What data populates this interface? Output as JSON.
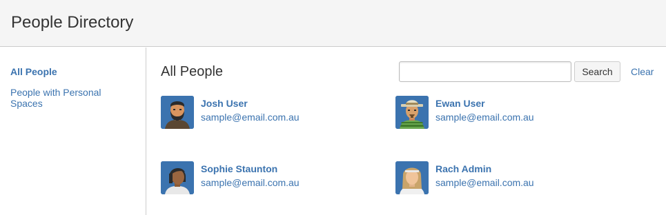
{
  "header": {
    "title": "People Directory"
  },
  "sidebar": {
    "items": [
      {
        "label": "All People",
        "active": true
      },
      {
        "label": "People with Personal Spaces",
        "active": false
      }
    ]
  },
  "main": {
    "title": "All People",
    "search": {
      "value": "",
      "placeholder": "",
      "button_label": "Search",
      "clear_label": "Clear"
    },
    "people": [
      {
        "name": "Josh User",
        "email": "sample@email.com.au",
        "avatar_icon": "bearded-man-avatar-icon"
      },
      {
        "name": "Ewan User",
        "email": "sample@email.com.au",
        "avatar_icon": "hat-man-avatar-icon"
      },
      {
        "name": "Sophie Staunton",
        "email": "sample@email.com.au",
        "avatar_icon": "dark-hair-woman-avatar-icon"
      },
      {
        "name": "Rach Admin",
        "email": "sample@email.com.au",
        "avatar_icon": "blonde-woman-avatar-icon"
      }
    ]
  },
  "colors": {
    "link": "#3b73af",
    "header_bg": "#f5f5f5",
    "border": "#cccccc",
    "avatar_bg": "#3b73af"
  }
}
